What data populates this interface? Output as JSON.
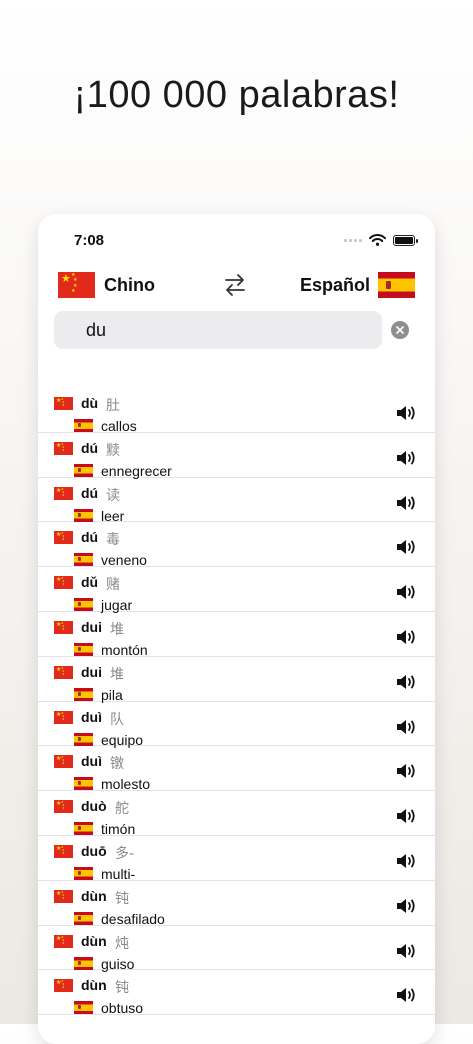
{
  "headline": "¡100 000 palabras!",
  "status_bar": {
    "time": "7:08"
  },
  "languages": {
    "source": {
      "label": "Chino",
      "flag": "china-flag"
    },
    "target": {
      "label": "Español",
      "flag": "spain-flag"
    }
  },
  "search": {
    "value": "du"
  },
  "colors": {
    "cn_red": "#e12a1c",
    "cn_star": "#ffde00",
    "es_red": "#c60b1e",
    "es_yellow": "#ffc400"
  },
  "results": [
    {
      "pinyin": "dù",
      "hanzi": "肚",
      "translation": "callos"
    },
    {
      "pinyin": "dú",
      "hanzi": "黩",
      "translation": "ennegrecer"
    },
    {
      "pinyin": "dú",
      "hanzi": "读",
      "translation": "leer"
    },
    {
      "pinyin": "dú",
      "hanzi": "毒",
      "translation": "veneno"
    },
    {
      "pinyin": "dǔ",
      "hanzi": "赌",
      "translation": "jugar"
    },
    {
      "pinyin": "dui",
      "hanzi": "堆",
      "translation": "montón"
    },
    {
      "pinyin": "dui",
      "hanzi": "堆",
      "translation": "pila"
    },
    {
      "pinyin": "duì",
      "hanzi": "队",
      "translation": "equipo"
    },
    {
      "pinyin": "duì",
      "hanzi": "镦",
      "translation": "molesto"
    },
    {
      "pinyin": "duò",
      "hanzi": "舵",
      "translation": "timón"
    },
    {
      "pinyin": "duō",
      "hanzi": "多-",
      "translation": "multi-"
    },
    {
      "pinyin": "dùn",
      "hanzi": "钝",
      "translation": "desafilado"
    },
    {
      "pinyin": "dùn",
      "hanzi": "炖",
      "translation": "guiso"
    },
    {
      "pinyin": "dùn",
      "hanzi": "钝",
      "translation": "obtuso"
    }
  ]
}
